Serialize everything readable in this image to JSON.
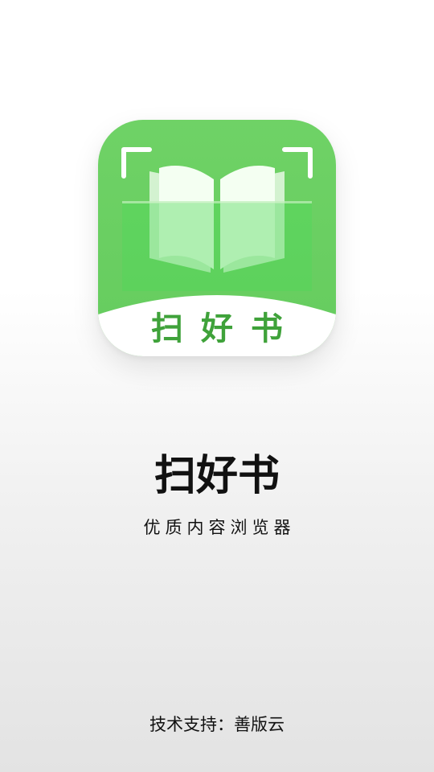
{
  "app": {
    "name": "扫好书",
    "icon_label": "扫好书",
    "tagline": "优质内容浏览器",
    "tech_support": "技术支持：善版云"
  },
  "icons": {
    "app_logo": "open-book-scan-icon"
  },
  "colors": {
    "brand_green": "#65cc5e",
    "label_green": "#3fa23a",
    "text": "#111111"
  }
}
